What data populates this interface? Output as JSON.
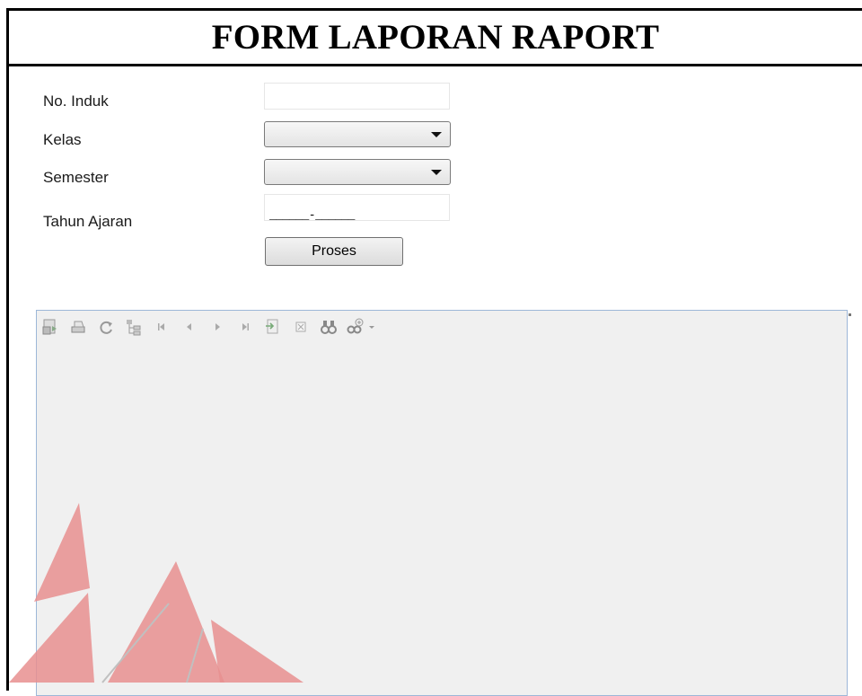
{
  "title": "FORM LAPORAN RAPORT",
  "fields": {
    "no_induk_label": "No. Induk",
    "kelas_label": "Kelas",
    "semester_label": "Semester",
    "tahun_ajaran_label": "Tahun Ajaran",
    "tahun_ajaran_mask": "______-______"
  },
  "process_button": "Proses",
  "report_toolbar": {
    "icons": [
      "export-report-icon",
      "print-icon",
      "refresh-icon",
      "group-tree-icon",
      "first-page-icon",
      "previous-page-icon",
      "next-page-icon",
      "last-page-icon",
      "go-to-page-icon",
      "close-view-icon",
      "find-text-icon",
      "zoom-icon"
    ]
  },
  "colors": {
    "viewer_border": "#9db7d8",
    "viewer_bg": "#f0f0f0",
    "watermark": "#e78f8f"
  }
}
